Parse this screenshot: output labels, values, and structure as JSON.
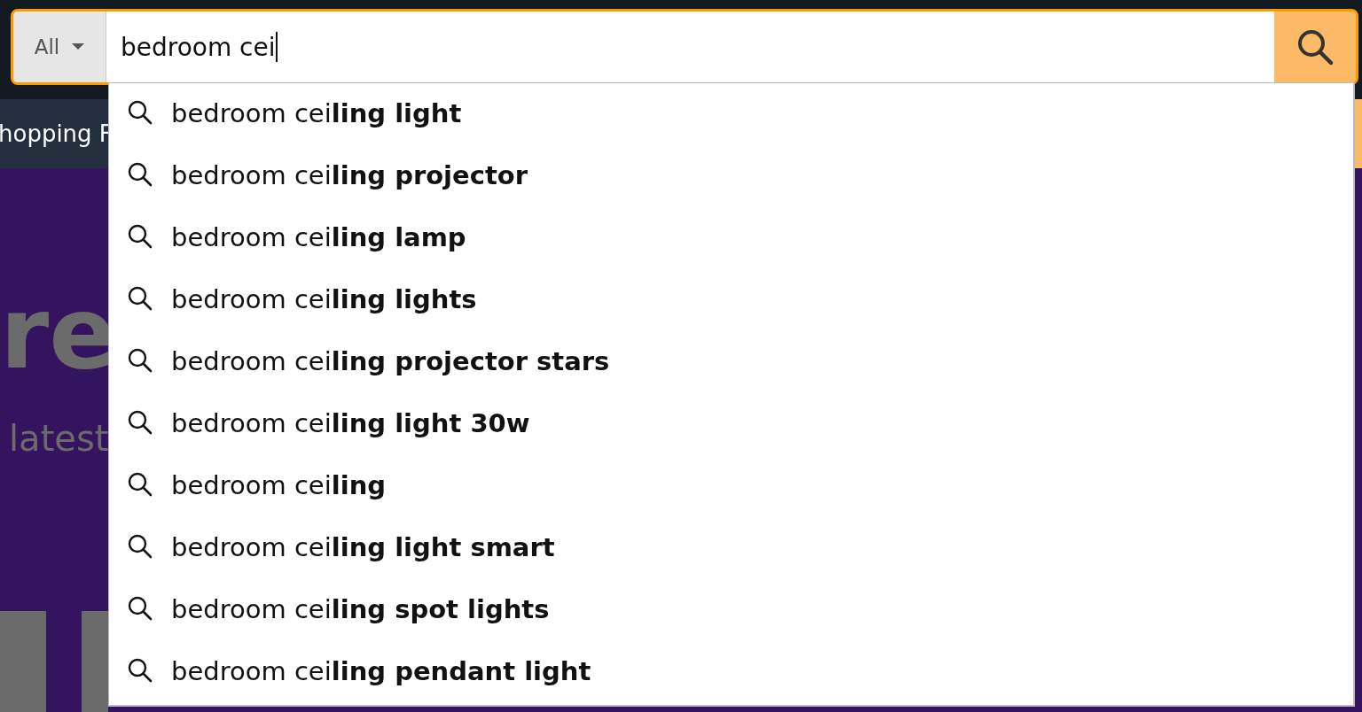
{
  "search": {
    "category": "All",
    "value": "bedroom cei"
  },
  "nav": {
    "text": "hopping F"
  },
  "hero": {
    "headline": "re",
    "subline": "latest"
  },
  "suggestions": [
    {
      "text": "bedroom cei**ling light**"
    },
    {
      "text": "bedroom cei**ling projector**"
    },
    {
      "text": "bedroom cei**ling lamp**"
    },
    {
      "text": "bedroom cei**ling lights**"
    },
    {
      "text": "bedroom cei**ling projector stars**"
    },
    {
      "text": "bedroom cei**ling light 30w**"
    },
    {
      "text": "bedroom cei**ling**"
    },
    {
      "text": "bedroom cei**ling light smart**"
    },
    {
      "text": "bedroom cei**ling spot lights**"
    },
    {
      "text": "bedroom cei**ling pendant light**"
    }
  ]
}
